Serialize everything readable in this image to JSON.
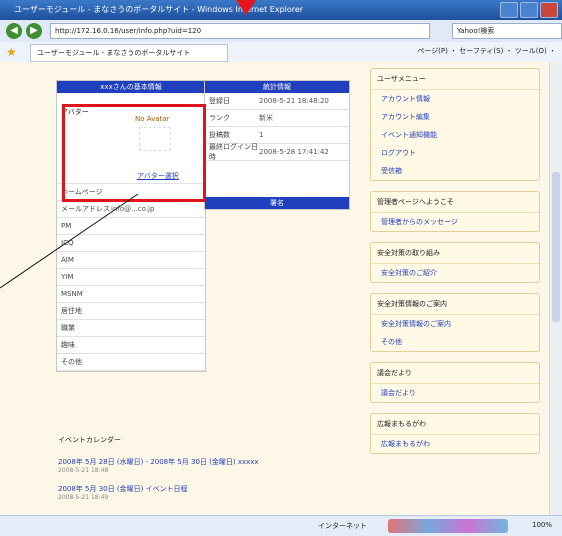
{
  "window": {
    "title": "ユーザーモジュール - まなさうのボータルサイト - Windows Internet Explorer",
    "url": "http://172.16.0.16/user/info.php?uid=120",
    "search_placeholder": "Yahoo!検索",
    "tab_title": "ユーザーモジュール - まなさうのボータルサイト",
    "toolbar": "ページ(P) ・ セーフティ(S) ・ ツール(O) ・",
    "status_zone": "インターネット",
    "zoom": "100%"
  },
  "profile": {
    "header": "xxxさんの基本情報",
    "avatar_label": "アバター",
    "avatar_text": "No Avatar",
    "avatar_link": "アバター選択",
    "rows": [
      {
        "k": "ホームページ",
        "v": ""
      },
      {
        "k": "メールアドレス",
        "v": "info@...co.jp"
      },
      {
        "k": "PM",
        "v": ""
      },
      {
        "k": "ICQ",
        "v": ""
      },
      {
        "k": "AIM",
        "v": ""
      },
      {
        "k": "YIM",
        "v": ""
      },
      {
        "k": "MSNM",
        "v": ""
      },
      {
        "k": "居住地",
        "v": ""
      },
      {
        "k": "職業",
        "v": ""
      },
      {
        "k": "趣味",
        "v": ""
      },
      {
        "k": "その他",
        "v": ""
      }
    ]
  },
  "stats": {
    "header": "統計情報",
    "rows": [
      {
        "k": "登録日",
        "v": "2008-5-21 18:48:20"
      },
      {
        "k": "ランク",
        "v": "新米"
      },
      {
        "k": "投稿数",
        "v": "1"
      },
      {
        "k": "最終ログイン日時",
        "v": "2008-5-28 17:41:42"
      }
    ],
    "sig_header": "署名"
  },
  "sidebar": [
    {
      "h": "ユーザメニュー",
      "items": [
        "アカウント情報",
        "アカウント編集",
        "イベント通知機能",
        "ログアウト",
        "受信箱"
      ]
    },
    {
      "h": "管理者ページへようこそ",
      "items": [
        "管理者からのメッセージ"
      ]
    },
    {
      "h": "安全対策の取り組み",
      "items": [
        "安全対策のご紹介"
      ]
    },
    {
      "h": "安全対策情報のご案内",
      "items": [
        "安全対策情報のご案内",
        "その他"
      ]
    },
    {
      "h": "議会だより",
      "items": [
        "議会だより"
      ]
    },
    {
      "h": "広報まもるがわ",
      "items": [
        "広報まもるがわ"
      ]
    }
  ],
  "events": {
    "header": "イベントカレンダー",
    "items": [
      {
        "t": "2008年 5月 28日 (水曜日) - 2008年 5月 30日 (金曜日)  xxxxx",
        "d": "2008-5-21 18:48"
      },
      {
        "t": "2008年 5月 30日 (金曜日)  イベント日程",
        "d": "2008-5-21 18:49"
      }
    ]
  }
}
